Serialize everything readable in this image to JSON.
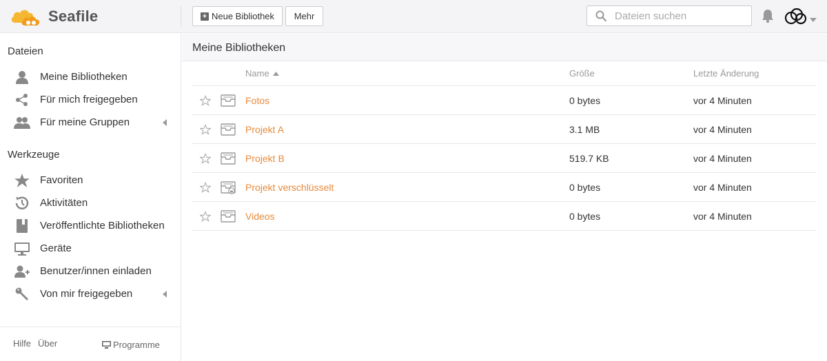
{
  "app": {
    "logo_text": "Seafile"
  },
  "toolbar": {
    "new_library_label": "Neue Bibliothek",
    "more_label": "Mehr"
  },
  "search": {
    "placeholder": "Dateien suchen"
  },
  "sidebar": {
    "files_heading": "Dateien",
    "files_items": [
      {
        "label": "Meine Bibliotheken",
        "icon": "user-icon"
      },
      {
        "label": "Für mich freigegeben",
        "icon": "share-icon"
      },
      {
        "label": "Für meine Gruppen",
        "icon": "group-icon"
      }
    ],
    "tools_heading": "Werkzeuge",
    "tools_items": [
      {
        "label": "Favoriten",
        "icon": "star-icon"
      },
      {
        "label": "Aktivitäten",
        "icon": "history-icon"
      },
      {
        "label": "Veröffentlichte Bibliotheken",
        "icon": "book-icon"
      },
      {
        "label": "Geräte",
        "icon": "monitor-icon"
      },
      {
        "label": "Benutzer/innen einladen",
        "icon": "user-plus-icon"
      },
      {
        "label": "Von mir freigegeben",
        "icon": "wrench-icon"
      }
    ],
    "footer": {
      "help": "Hilfe",
      "about": "Über",
      "programs": "Programme"
    }
  },
  "main": {
    "title": "Meine Bibliotheken",
    "columns": {
      "name": "Name",
      "size": "Größe",
      "modified": "Letzte Änderung"
    },
    "libraries": [
      {
        "name": "Fotos",
        "size": "0 bytes",
        "modified": "vor 4 Minuten",
        "encrypted": false
      },
      {
        "name": "Projekt A",
        "size": "3.1 MB",
        "modified": "vor 4 Minuten",
        "encrypted": false
      },
      {
        "name": "Projekt B",
        "size": "519.7 KB",
        "modified": "vor 4 Minuten",
        "encrypted": false
      },
      {
        "name": "Projekt verschlüsselt",
        "size": "0 bytes",
        "modified": "vor 4 Minuten",
        "encrypted": true
      },
      {
        "name": "Videos",
        "size": "0 bytes",
        "modified": "vor 4 Minuten",
        "encrypted": false
      }
    ]
  },
  "colors": {
    "accent": "#e68a3b",
    "logo_orange": "#f5a623",
    "icon_grey": "#888888"
  }
}
